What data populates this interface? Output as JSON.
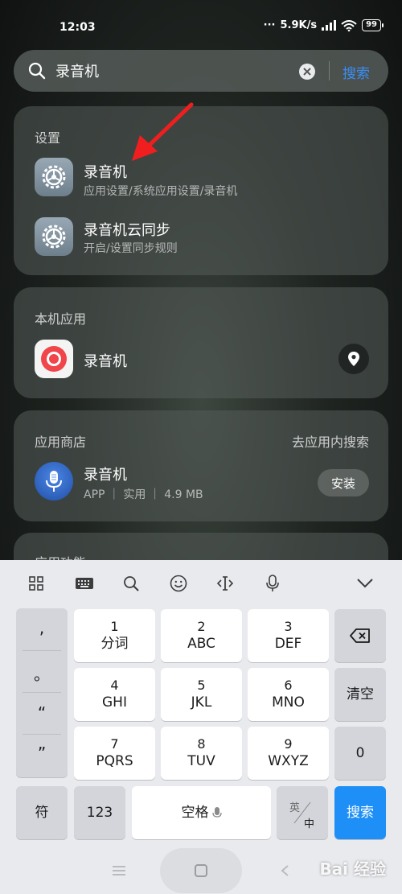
{
  "status": {
    "time": "12:03",
    "speed": "5.9K/s",
    "battery": "99"
  },
  "search": {
    "query": "录音机",
    "button": "搜索"
  },
  "settings_section": {
    "title": "设置",
    "items": [
      {
        "title": "录音机",
        "subtitle": "应用设置/系统应用设置/录音机"
      },
      {
        "title": "录音机云同步",
        "subtitle": "开启/设置同步规则"
      }
    ]
  },
  "local_section": {
    "title": "本机应用",
    "item": {
      "title": "录音机"
    }
  },
  "store_section": {
    "title": "应用商店",
    "link": "去应用内搜索",
    "item": {
      "title": "录音机",
      "meta": "APP ｜ 实用 ｜ 4.9 MB",
      "install": "安装"
    }
  },
  "next_section": {
    "title": "应用功能"
  },
  "keyboard": {
    "punct": [
      ",",
      "。",
      "“",
      "”"
    ],
    "keys": [
      {
        "num": "1",
        "letters": "分词"
      },
      {
        "num": "2",
        "letters": "ABC"
      },
      {
        "num": "3",
        "letters": "DEF"
      },
      {
        "num": "4",
        "letters": "GHI"
      },
      {
        "num": "5",
        "letters": "JKL"
      },
      {
        "num": "6",
        "letters": "MNO"
      },
      {
        "num": "7",
        "letters": "PQRS"
      },
      {
        "num": "8",
        "letters": "TUV"
      },
      {
        "num": "9",
        "letters": "WXYZ"
      }
    ],
    "clear": "清空",
    "zero": "0",
    "symbol": "符",
    "num123": "123",
    "space": "空格",
    "lang_top": "英",
    "lang_bottom": "中",
    "search": "搜索"
  },
  "watermark": "Bai 经验",
  "colors": {
    "accent": "#3a8ef6",
    "record_red": "#f0454a",
    "search_key": "#1e8ff6"
  }
}
